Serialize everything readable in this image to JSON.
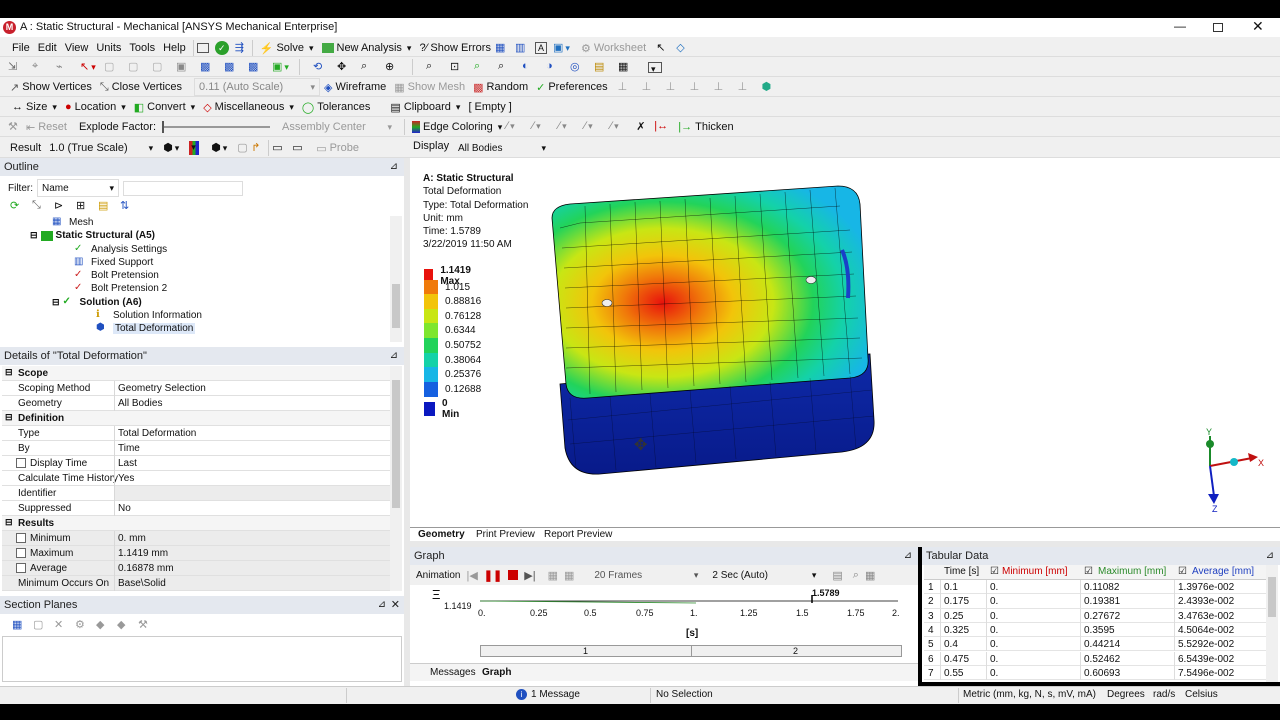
{
  "window": {
    "title": "A : Static Structural - Mechanical [ANSYS Mechanical Enterprise]"
  },
  "menubar": [
    "File",
    "Edit",
    "View",
    "Units",
    "Tools",
    "Help"
  ],
  "toolbar1": {
    "solve": "Solve",
    "new_analysis": "New Analysis",
    "show_errors": "Show Errors",
    "worksheet": "Worksheet"
  },
  "toolbar3": {
    "show_vertices": "Show Vertices",
    "close_vertices": "Close Vertices",
    "auto_scale": "0.11 (Auto Scale)",
    "wireframe": "Wireframe",
    "show_mesh": "Show Mesh",
    "random": "Random",
    "preferences": "Preferences"
  },
  "toolbar4": {
    "size": "Size",
    "location": "Location",
    "convert": "Convert",
    "miscellaneous": "Miscellaneous",
    "tolerances": "Tolerances",
    "clipboard": "Clipboard",
    "empty": "[ Empty ]"
  },
  "toolbar5": {
    "reset": "Reset",
    "explode_factor": "Explode Factor:",
    "assembly_center": "Assembly Center",
    "edge_coloring": "Edge Coloring",
    "thicken": "Thicken"
  },
  "result_bar": {
    "result_label": "Result",
    "scale": "1.0 (True Scale)",
    "probe": "Probe",
    "display_label": "Display",
    "display_value": "All Bodies"
  },
  "outline": {
    "title": "Outline",
    "filter_label": "Filter:",
    "filter_value": "Name",
    "items": [
      {
        "label": "Mesh",
        "bold": false
      },
      {
        "label": "Static Structural (A5)",
        "bold": true
      },
      {
        "label": "Analysis Settings",
        "bold": false
      },
      {
        "label": "Fixed Support",
        "bold": false
      },
      {
        "label": "Bolt Pretension",
        "bold": false
      },
      {
        "label": "Bolt Pretension 2",
        "bold": false
      },
      {
        "label": "Solution (A6)",
        "bold": true
      },
      {
        "label": "Solution Information",
        "bold": false
      },
      {
        "label": "Total Deformation",
        "bold": false
      }
    ]
  },
  "details": {
    "title": "Details of \"Total Deformation\"",
    "groups": {
      "scope": "Scope",
      "definition": "Definition",
      "results": "Results"
    },
    "rows": {
      "scoping_method": {
        "k": "Scoping Method",
        "v": "Geometry Selection"
      },
      "geometry": {
        "k": "Geometry",
        "v": "All Bodies"
      },
      "type": {
        "k": "Type",
        "v": "Total Deformation"
      },
      "by": {
        "k": "By",
        "v": "Time"
      },
      "display_time": {
        "k": "Display Time",
        "v": "Last"
      },
      "calc_time_history": {
        "k": "Calculate Time History",
        "v": "Yes"
      },
      "identifier": {
        "k": "Identifier",
        "v": ""
      },
      "suppressed": {
        "k": "Suppressed",
        "v": "No"
      },
      "minimum": {
        "k": "Minimum",
        "v": "0. mm"
      },
      "maximum": {
        "k": "Maximum",
        "v": "1.1419 mm"
      },
      "average": {
        "k": "Average",
        "v": "0.16878 mm"
      },
      "min_occurs": {
        "k": "Minimum Occurs On",
        "v": "Base\\Solid"
      }
    }
  },
  "section_planes": {
    "title": "Section Planes"
  },
  "viewport": {
    "info": {
      "analysis": "A: Static Structural",
      "result": "Total Deformation",
      "type": "Type: Total Deformation",
      "unit": "Unit: mm",
      "time": "Time: 1.5789",
      "date": "3/22/2019 11:50 AM"
    },
    "legend": [
      {
        "label": "1.1419 Max",
        "color": "#e8120c"
      },
      {
        "label": "1.015",
        "color": "#f07a0a"
      },
      {
        "label": "0.88816",
        "color": "#f2c40a"
      },
      {
        "label": "0.76128",
        "color": "#c8e614"
      },
      {
        "label": "0.6344",
        "color": "#7ee62e"
      },
      {
        "label": "0.50752",
        "color": "#22d35a"
      },
      {
        "label": "0.38064",
        "color": "#14d2a8"
      },
      {
        "label": "0.25376",
        "color": "#17b6e6"
      },
      {
        "label": "0.12688",
        "color": "#1560e0"
      },
      {
        "label": "0 Min",
        "color": "#0a18c0"
      }
    ],
    "tabs": [
      "Geometry",
      "Print Preview",
      "Report Preview"
    ],
    "axes": {
      "y": "Y",
      "x": "X",
      "z": "Z"
    }
  },
  "graph": {
    "title": "Graph",
    "animation": "Animation",
    "frames": "20 Frames",
    "speed": "2 Sec (Auto)",
    "ymax": "1.1419",
    "marker": "1.5789",
    "xticks": [
      "0.",
      "0.25",
      "0.5",
      "0.75",
      "1.",
      "1.25",
      "1.5",
      "1.75",
      "2."
    ],
    "xlabel": "[s]",
    "steps": [
      "1",
      "2"
    ],
    "tabs": [
      "Messages",
      "Graph"
    ]
  },
  "tabular": {
    "title": "Tabular Data",
    "headers": [
      "Time [s]",
      "Minimum [mm]",
      "Maximum [mm]",
      "Average [mm]"
    ],
    "rows": [
      [
        "1",
        "0.1",
        "0.",
        "0.11082",
        "1.3976e-002"
      ],
      [
        "2",
        "0.175",
        "0.",
        "0.19381",
        "2.4393e-002"
      ],
      [
        "3",
        "0.25",
        "0.",
        "0.27672",
        "3.4763e-002"
      ],
      [
        "4",
        "0.325",
        "0.",
        "0.3595",
        "4.5064e-002"
      ],
      [
        "5",
        "0.4",
        "0.",
        "0.44214",
        "5.5292e-002"
      ],
      [
        "6",
        "0.475",
        "0.",
        "0.52462",
        "6.5439e-002"
      ],
      [
        "7",
        "0.55",
        "0.",
        "0.60693",
        "7.5496e-002"
      ]
    ]
  },
  "statusbar": {
    "messages": "1 Message",
    "selection": "No Selection",
    "units": "Metric (mm, kg, N, s, mV, mA)",
    "degrees": "Degrees",
    "rads": "rad/s",
    "celsius": "Celsius"
  }
}
